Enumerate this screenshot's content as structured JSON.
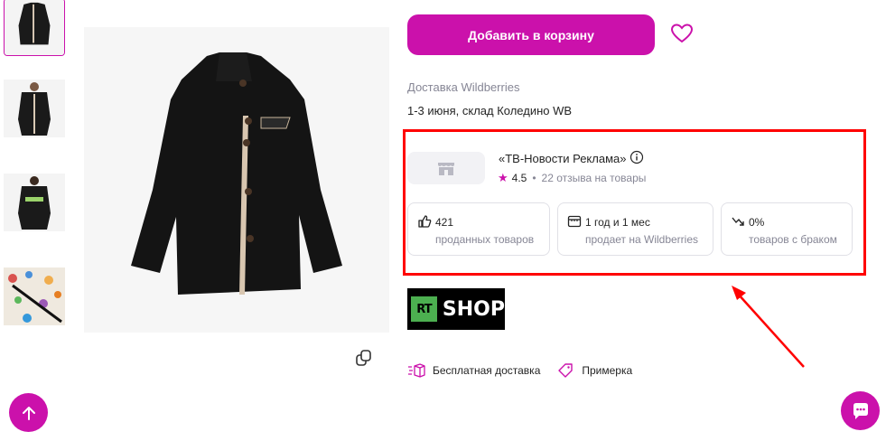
{
  "product": {
    "add_to_cart_label": "Добавить в корзину",
    "delivery_title": "Доставка Wildberries",
    "delivery_date": "1-3 июня, склад Коледино WB"
  },
  "seller": {
    "name": "«ТВ-Новости Реклама»",
    "rating": "4.5",
    "reviews": "22 отзыва на товары",
    "stats": [
      {
        "value": "421",
        "label": "проданных товаров",
        "icon": "thumbs-up-icon"
      },
      {
        "value": "1 год и 1 мес",
        "label": "продает на Wildberries",
        "icon": "store-icon"
      },
      {
        "value": "0%",
        "label": "товаров с браком",
        "icon": "trend-down-icon"
      }
    ]
  },
  "brand": {
    "badge": "RT",
    "name": "SHOP"
  },
  "features": [
    {
      "label": "Бесплатная доставка",
      "icon": "delivery-icon"
    },
    {
      "label": "Примерка",
      "icon": "tag-icon"
    }
  ],
  "colors": {
    "accent": "#cb11ab",
    "highlight_border": "#ff0000",
    "muted_text": "#868695"
  }
}
